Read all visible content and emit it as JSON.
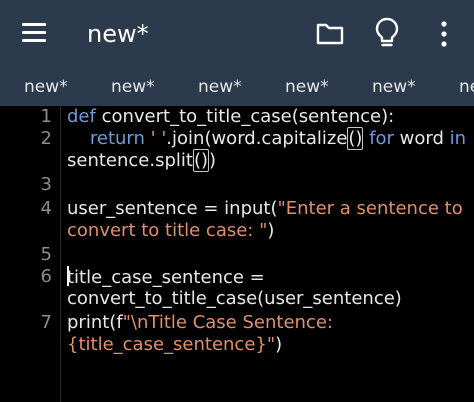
{
  "app": {
    "title": "new*",
    "colors": {
      "toolbar_bg": "#2b3a4c",
      "editor_bg": "#000000",
      "keyword": "#6f9bd8",
      "string": "#e0906a",
      "text": "#e8e8e8",
      "line_number": "#8c8c8c"
    }
  },
  "toolbar": {
    "menu_icon": "hamburger-menu",
    "folder_icon": "folder",
    "bulb_icon": "lightbulb",
    "more_icon": "vertical-ellipsis"
  },
  "tabs": [
    {
      "label": "new*"
    },
    {
      "label": "new*"
    },
    {
      "label": "new*"
    },
    {
      "label": "new*"
    },
    {
      "label": "new*"
    },
    {
      "label": "ne"
    }
  ],
  "editor": {
    "line_numbers": [
      "1",
      "2",
      "3",
      "4",
      "5",
      "6",
      "7"
    ],
    "lines": {
      "l1_kw": "def",
      "l1_rest": " convert_to_title_case(sentence):",
      "l2_indent": "    ",
      "l2_kw": "return",
      "l2_sp": " ",
      "l2_str": "' '",
      "l2_rest": ".join(word.capitalize",
      "l2_paren": "()",
      "l2_sp2": " ",
      "l2_for": "for",
      "l2_mid": " word ",
      "l2_in": "in",
      "l2b_rest": "sentence.split",
      "l2b_paren": "()",
      "l2b_close": ")",
      "l4_rest": "user_sentence = input(",
      "l4_str": "\"Enter a sentence to",
      "l4b_str": "convert to title case: \"",
      "l4b_close": ")",
      "l6_rest": "title_case_sentence =",
      "l6b_rest": "convert_to_title_case(user_sentence)",
      "l7_rest": "print(f",
      "l7_str": "\"\\nTitle Case Sentence:",
      "l7b_str": "{title_case_sentence}\"",
      "l7b_close": ")"
    }
  }
}
